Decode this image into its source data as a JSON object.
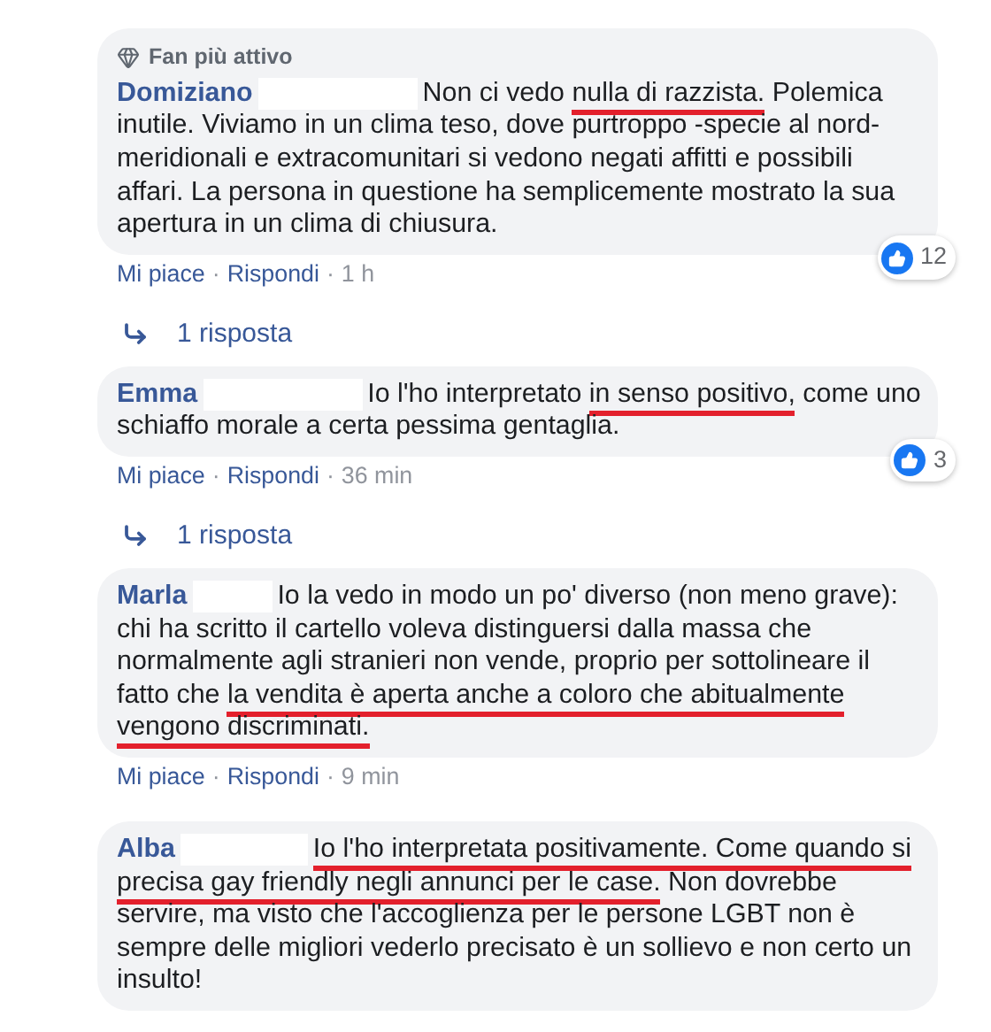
{
  "comments": [
    {
      "badge": "Fan più attivo",
      "author": "Domiziano",
      "redacted": true,
      "text": [
        {
          "text": "Non ci vedo ",
          "underlined": false
        },
        {
          "text": "nulla di razzista.",
          "underlined": true
        },
        {
          "text": " Polemica inutile. Viviamo in un clima teso, dove purtroppo -specie al nord- meridionali e extracomunitari si vedono negati affitti e possibili affari. La persona in questione ha semplicemente mostrato la sua apertura in un clima di chiusura.",
          "underlined": false
        }
      ],
      "reactions": "12",
      "actions": {
        "like": "Mi piace",
        "separator": "·",
        "reply": "Rispondi",
        "time": "1 h"
      },
      "replies": "1 risposta"
    },
    {
      "author": "Emma",
      "redacted": true,
      "text": [
        {
          "text": "Io l'ho interpretato ",
          "underlined": false
        },
        {
          "text": "in senso positivo,",
          "underlined": true
        },
        {
          "text": " come uno schiaffo morale a certa pessima gentaglia.",
          "underlined": false
        }
      ],
      "reactions": "3",
      "actions": {
        "like": "Mi piace",
        "separator": "·",
        "reply": "Rispondi",
        "time": "36 min"
      },
      "replies": "1 risposta"
    },
    {
      "author": "Marla",
      "redacted": true,
      "text": [
        {
          "text": "Io la vedo in modo un po' diverso (non meno grave): chi ha scritto il cartello voleva distinguersi dalla massa che normalmente agli stranieri non vende, proprio per sottolineare il fatto che ",
          "underlined": false
        },
        {
          "text": "la vendita è aperta anche a coloro che abitualmente vengono discriminati.",
          "underlined": true
        }
      ],
      "actions": {
        "like": "Mi piace",
        "separator": "·",
        "reply": "Rispondi",
        "time": "9 min"
      }
    },
    {
      "author": "Alba",
      "redacted": true,
      "text": [
        {
          "text": "Io l'ho interpretata positivamente. Come quando si precisa gay friendly negli annunci per le case.",
          "underlined": true
        },
        {
          "text": " Non dovrebbe servire, ma visto che l'accoglienza per le persone LGBT non è sempre delle migliori vederlo precisato è un sollievo e non certo un insulto!",
          "underlined": false
        }
      ]
    }
  ]
}
